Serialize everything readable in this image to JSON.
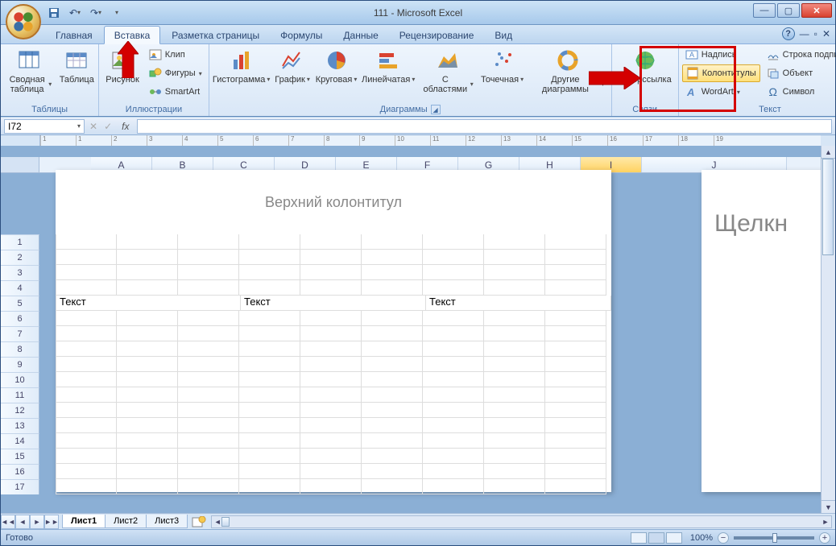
{
  "title": "111 - Microsoft Excel",
  "tabs": [
    "Главная",
    "Вставка",
    "Разметка страницы",
    "Формулы",
    "Данные",
    "Рецензирование",
    "Вид"
  ],
  "active_tab": 1,
  "ribbon": {
    "tables": {
      "label": "Таблицы",
      "pivot": "Сводная таблица",
      "table": "Таблица"
    },
    "illustrations": {
      "label": "Иллюстрации",
      "picture": "Рисунок",
      "clip": "Клип",
      "shapes": "Фигуры",
      "smartart": "SmartArt"
    },
    "charts": {
      "label": "Диаграммы",
      "column": "Гистограмма",
      "line": "График",
      "pie": "Круговая",
      "bar": "Линейчатая",
      "area": "С областями",
      "scatter": "Точечная",
      "other": "Другие диаграммы"
    },
    "links": {
      "label": "Связи",
      "hyperlink": "Гиперссылка"
    },
    "text": {
      "label": "Текст",
      "textbox": "Надпись",
      "headerfooter": "Колонтитулы",
      "wordart": "WordArt",
      "sigline": "Строка подписи",
      "object": "Объект",
      "symbol": "Символ"
    }
  },
  "namebox": "I72",
  "columns": [
    "A",
    "B",
    "C",
    "D",
    "E",
    "F",
    "G",
    "H",
    "I",
    "J"
  ],
  "selected_col": "I",
  "rows": [
    1,
    2,
    3,
    4,
    5,
    6,
    7,
    8,
    9,
    10,
    11,
    12,
    13,
    14,
    15,
    16,
    17
  ],
  "ruler_marks": [
    "1",
    "1",
    "2",
    "3",
    "4",
    "5",
    "6",
    "7",
    "8",
    "9",
    "10",
    "11",
    "12",
    "13",
    "14",
    "15",
    "16",
    "17",
    "18",
    "19"
  ],
  "header_title": "Верхний колонтитул",
  "header_cells": [
    "Текст",
    "Текст",
    "Текст"
  ],
  "page2_hint": "Щелкн",
  "sheets": [
    "Лист1",
    "Лист2",
    "Лист3"
  ],
  "active_sheet": 0,
  "status_text": "Готово",
  "zoom": "100%"
}
